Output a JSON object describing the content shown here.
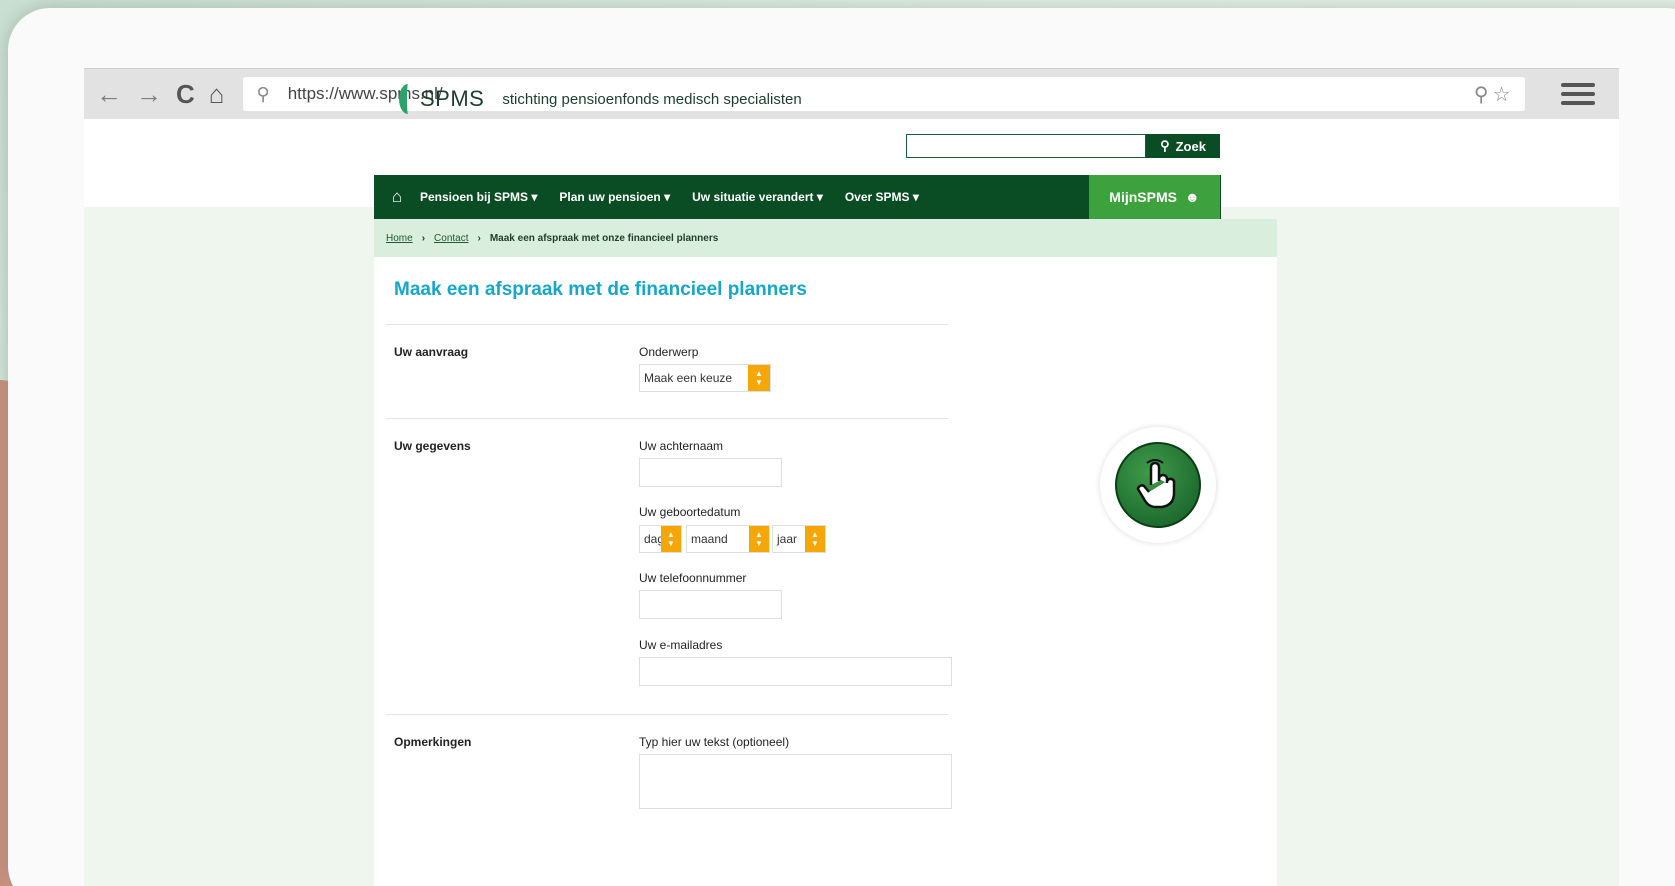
{
  "browser": {
    "url": "https://www.spms.nl/",
    "back_icon": "←",
    "forward_icon": "→",
    "reload_icon": "C"
  },
  "site": {
    "logo_text": "SPMS",
    "tagline": "stichting pensioenfonds medisch specialisten",
    "search_button": "Zoek",
    "nav": [
      "Pensioen bij SPMS",
      "Plan uw pensioen",
      "Uw situatie verandert",
      "Over SPMS"
    ],
    "mijn_label": "MijnSPMS"
  },
  "breadcrumb": {
    "home": "Home",
    "contact": "Contact",
    "current": "Maak een afspraak met onze financieel planners"
  },
  "form": {
    "title": "Maak een afspraak met de financieel planners",
    "section_request": "Uw aanvraag",
    "subject_label": "Onderwerp",
    "subject_value": "Maak een keuze",
    "section_details": "Uw gegevens",
    "lastname_label": "Uw achternaam",
    "birthdate_label": "Uw geboortedatum",
    "day_value": "dag",
    "month_value": "maand",
    "year_value": "jaar",
    "phone_label": "Uw telefoonnummer",
    "email_label": "Uw e-mailadres",
    "section_remarks": "Opmerkingen",
    "remarks_label": "Typ hier uw tekst (optioneel)"
  },
  "colors": {
    "nav_green": "#0a4d25",
    "mijn_green": "#3da23e",
    "title_blue": "#16a6c9",
    "select_orange": "#f5a70a"
  }
}
